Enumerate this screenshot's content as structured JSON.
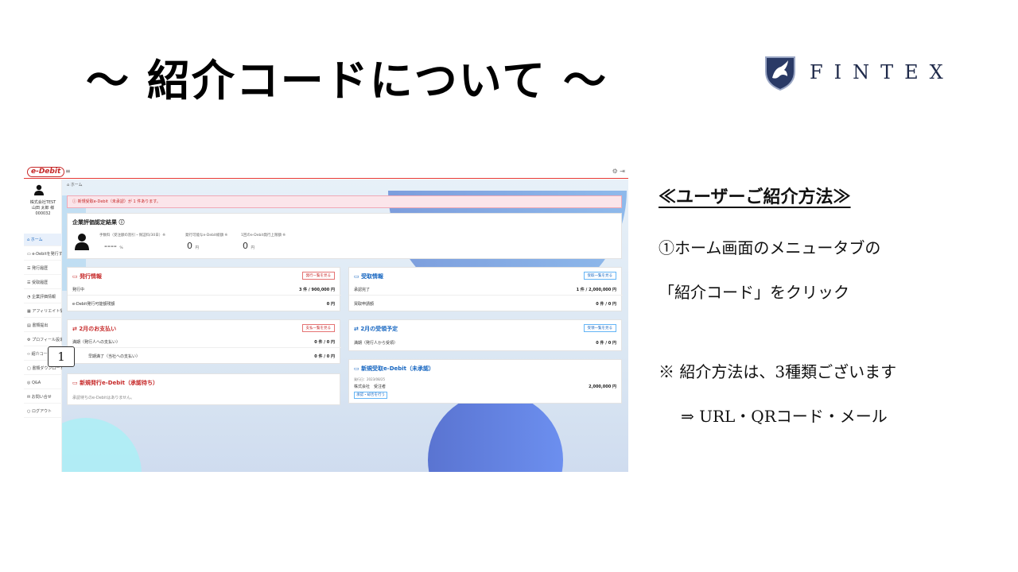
{
  "slide": {
    "title": "～ 紹介コードについて ～",
    "brand": "FINTEX"
  },
  "explain": {
    "heading": "≪ユーザーご紹介方法≫",
    "line1": "①ホーム画面のメニュータブの",
    "line2": "「紹介コード」をクリック",
    "note": "※ 紹介方法は、3種類ございます",
    "methods": "⇒ URL・QRコード・メール"
  },
  "colors": {
    "accent_red": "#c62828",
    "accent_blue": "#1565c0",
    "brand_navy": "#1f2a4a"
  },
  "app": {
    "logo": "e-Debit",
    "user": {
      "company": "株式会社TEST",
      "name": "山田 太郎 様",
      "id": "000032"
    },
    "sidebar": [
      {
        "label": "ホーム",
        "icon": "home-icon"
      },
      {
        "label": "e-Debitを発行する",
        "icon": "issue-icon"
      },
      {
        "label": "発行履歴",
        "icon": "list-icon"
      },
      {
        "label": "受取履歴",
        "icon": "list-icon"
      },
      {
        "label": "企業評価情報",
        "icon": "chart-icon"
      },
      {
        "label": "アフィリエイト情報",
        "icon": "affiliate-icon"
      },
      {
        "label": "書類提出",
        "icon": "document-icon"
      },
      {
        "label": "プロフィール設定",
        "icon": "gear-icon"
      },
      {
        "label": "紹介コード",
        "icon": "code-icon"
      },
      {
        "label": "書類ダウンロード",
        "icon": "download-icon"
      },
      {
        "label": "Q&A",
        "icon": "question-icon"
      },
      {
        "label": "お問い合せ",
        "icon": "mail-icon"
      },
      {
        "label": "ログアウト",
        "icon": "logout-icon"
      }
    ],
    "callout": "1",
    "breadcrumb": "ホーム",
    "alert": "新規受取e-Debit（未承認）が 1 件あります。",
    "evaluation": {
      "title": "企業評価認定結果",
      "label1": "手数料（受注額の割引・保証料/30日）※",
      "value1": "----",
      "unit1": "%",
      "label2": "発行可能なe-Debit総額 ※",
      "value2": "0",
      "unit2": "円",
      "label3": "1回のe-Debit発行上限額 ※",
      "value3": "0",
      "unit3": "円"
    },
    "cards": {
      "issue": {
        "title": "発行情報",
        "button": "発行一覧を見る",
        "row1_label": "発行中",
        "row1_value": "3 件 / 900,000 円",
        "row2_label": "e-Debit発行可能額残額",
        "row2_value": "0 円"
      },
      "receive": {
        "title": "受取情報",
        "button": "受取一覧を見る",
        "row1_label": "承認完了",
        "row1_value": "1 件 / 2,000,000 円",
        "row2_label": "買取申請額",
        "row2_value": "0 件 / 0 円"
      },
      "payment": {
        "title": "2月のお支払い",
        "button": "支払一覧を見る",
        "row1_label": "満期（発行人への支払い）",
        "row1_value": "0 件 / 0 円",
        "row2_label": "早期満了（当社への支払い）",
        "row2_value": "0 件 / 0 円"
      },
      "planned": {
        "title": "2月の受領予定",
        "button": "受領一覧を見る",
        "row1_label": "満期（発行人から受領）",
        "row1_value": "0 件 / 0 円"
      },
      "new_issue": {
        "title": "新規発行e-Debit（承認待ち）",
        "empty": "承認待ちのe-Debitはありません。"
      },
      "new_receive": {
        "title": "新規受取e-Debit（未承認）",
        "date": "発行日：2023/08/25",
        "company": "株式会社　受注者",
        "amount": "2,000,000 円",
        "tag": "承認・却否を行う"
      }
    }
  }
}
